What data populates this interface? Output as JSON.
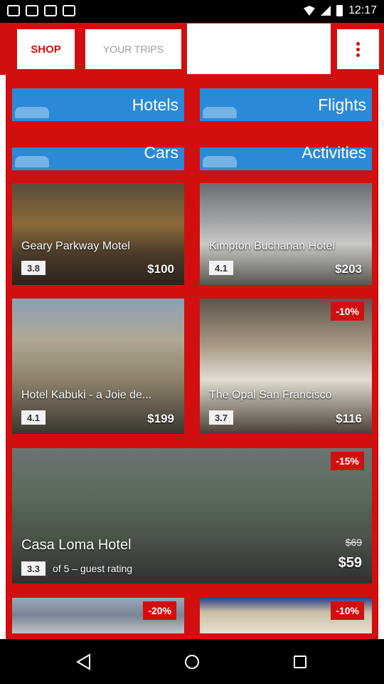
{
  "status_bar": {
    "time": "12:17",
    "icons": [
      "notification-icon",
      "notification-icon",
      "notification-icon",
      "notification-icon",
      "wifi-icon",
      "signal-icon",
      "battery-icon"
    ]
  },
  "app_bar": {
    "tabs": [
      {
        "label": "SHOP",
        "selected": true
      },
      {
        "label": "YOUR TRIPS",
        "selected": false
      }
    ],
    "menu_icon": "more-vert-icon"
  },
  "categories": [
    {
      "label": "Hotels",
      "icon": "bed-icon"
    },
    {
      "label": "Flights",
      "icon": "airplane-icon"
    },
    {
      "label": "Cars",
      "icon": "car-icon"
    },
    {
      "label": "Activities",
      "icon": "ticket-icon"
    }
  ],
  "hotels": [
    {
      "name": "Geary Parkway Motel",
      "rating": "3.8",
      "price": "$100"
    },
    {
      "name": "Kimpton Buchanan Hotel",
      "rating": "4.1",
      "price": "$203"
    },
    {
      "name": "Hotel Kabuki - a Joie de...",
      "rating": "4.1",
      "price": "$199"
    },
    {
      "name": "The Opal San Francisco",
      "rating": "3.7",
      "price": "$116",
      "discount": "-10%"
    },
    {
      "name": "Casa Loma Hotel",
      "rating": "3.3",
      "rating_note": "of 5 – guest rating",
      "old_price": "$69",
      "price": "$59",
      "discount": "-15%"
    },
    {
      "discount": "-20%"
    },
    {
      "discount": "-10%"
    }
  ],
  "colors": {
    "brand_red": "#d10f0f",
    "category_blue": "#2a8ad8",
    "status_bar": "#000000"
  },
  "nav_bar": {
    "icons": [
      "back-icon",
      "home-icon",
      "recents-icon"
    ]
  }
}
